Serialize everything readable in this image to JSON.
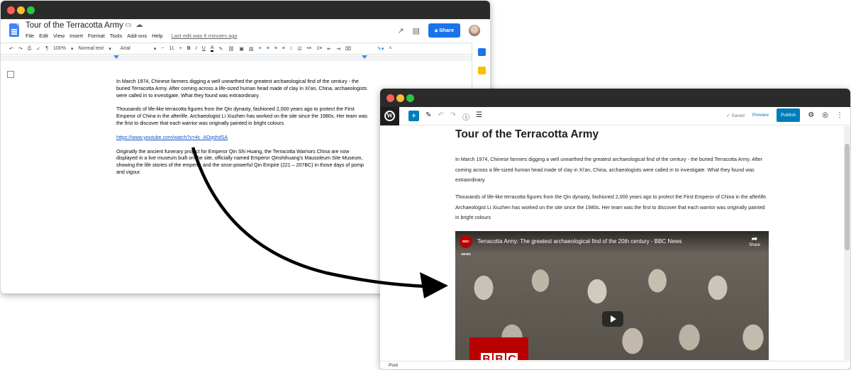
{
  "gdoc": {
    "title": "Tour of the Terracotta Army",
    "menu": [
      "File",
      "Edit",
      "View",
      "Insert",
      "Format",
      "Tools",
      "Add-ons",
      "Help"
    ],
    "last_edit": "Last edit was 6 minutes ago",
    "share_label": "Share",
    "toolbar": {
      "zoom": "100%",
      "style": "Normal text",
      "font": "Arial",
      "size": "11"
    },
    "body": [
      "In March 1974, Chinese farmers digging a well unearthed the greatest archaeological find of the century - the buried Terracotta Army.  After coming across a life-sized human head made of clay in Xi'an, China, archaeologists were called in to investigate.  What they found was extraordinary.",
      "Thousands of life-like terracotta figures from the Qin dynasty, fashioned 2,000 years ago to protect the First Emperor of China in the afterlife.  Archaeologist Li Xiuzhen has worked on the site since the 1980s.  Her team was the first to discover that each warrior was originally painted in bright colours",
      "Originally the ancient funerary project for Emperor Qin Shi Huang, the Terracotta Warriors China are now displayed in a live museum built on the site, officially named Emperor Qinshihuang's Mausoleum Site Museum, showing the life stories of the emperor and the once-powerful Qin Empire (221 – 207BC) in those days of pomp and vigour."
    ],
    "link": "https://www.youtube.com/watch?v=4c_ADqshdSA"
  },
  "wp": {
    "saved": "Saved",
    "preview": "Preview",
    "publish": "Publish",
    "post_title": "Tour of the Terracotta Army",
    "paragraphs": [
      "In March 1974, Chinese farmers digging a well unearthed the greatest archaeological find of the century - the buried Terracotta Army.  After coming across a life-sized human head made of clay in Xi'an, China, archaeologists were called in to investigate.  What they found was extraordinary.",
      "Thousands of life-like terracotta figures from the Qin dynasty, fashioned 2,000 years ago to protect the First Emperor of China in the afterlife.  Archaeologist Li Xiuzhen has worked on the site since the 1980s.  Her team was the first to discover that each warrior was originally painted in bright colours"
    ],
    "video": {
      "channel": "BBC NEWS",
      "title": "Terracotta Army: The greatest archaeological find of the 20th century - BBC News",
      "share": "Share",
      "logo": "BBC"
    },
    "footer": "Post"
  }
}
